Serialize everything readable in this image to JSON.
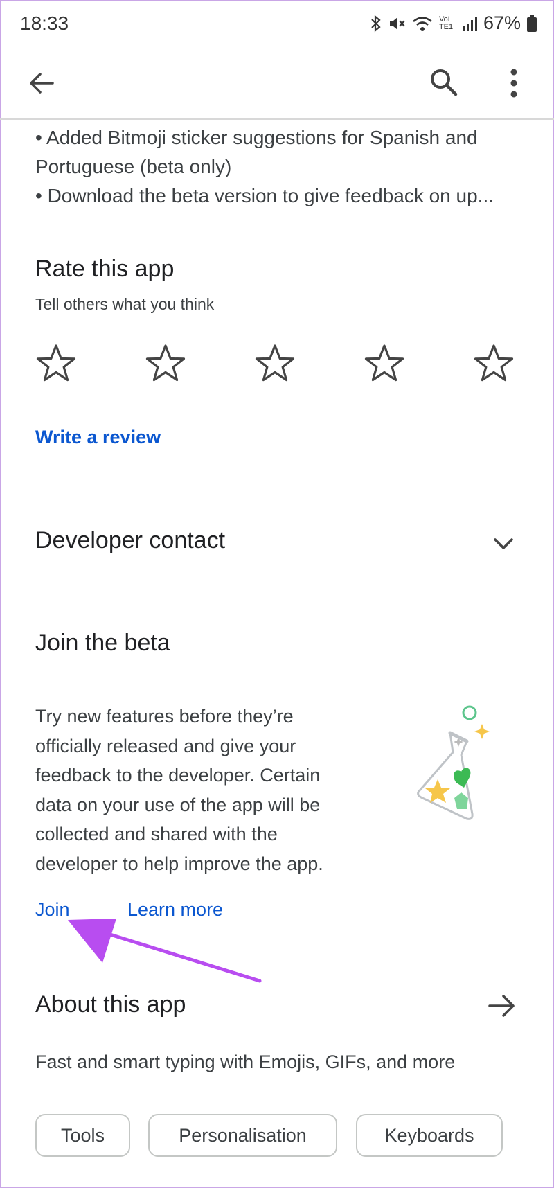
{
  "status_bar": {
    "time": "18:33",
    "battery": "67%",
    "network_label": "VoLTE1"
  },
  "content": {
    "bullets": [
      "• Added Bitmoji sticker suggestions for Spanish and",
      "Portuguese (beta only)",
      "• Download the beta version to give feedback on up..."
    ]
  },
  "rate": {
    "title": "Rate this app",
    "subtitle": "Tell others what you think",
    "stars": 5,
    "write_review": "Write a review"
  },
  "developer_contact": {
    "title": "Developer contact"
  },
  "beta": {
    "title": "Join the beta",
    "body_lines": [
      "Try new features before they’re",
      "officially released and give your",
      "feedback to the developer. Certain",
      "data on your use of the app will be",
      "collected and shared with the",
      "developer to help improve the app."
    ],
    "join": "Join",
    "learn_more": "Learn more"
  },
  "about": {
    "title": "About this app",
    "description": "Fast and smart typing with Emojis, GIFs, and more",
    "chips": [
      "Tools",
      "Personalisation",
      "Keyboards"
    ]
  },
  "colors": {
    "link": "#0b57d0",
    "annotation_arrow": "#b84df0"
  }
}
